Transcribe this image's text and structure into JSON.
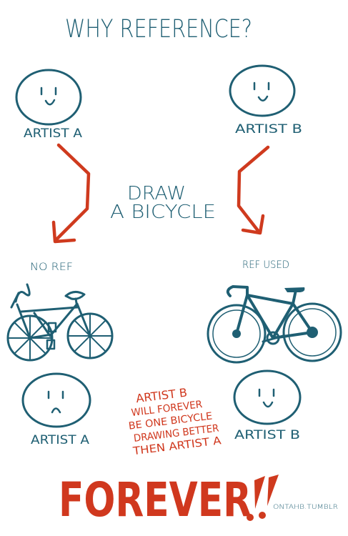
{
  "title": "WHY REFERENCE?",
  "artist_a_top": "ARTIST A",
  "artist_b_top": "ARTIST B",
  "task_line1": "DRAW",
  "task_line2": "A BICYCLE",
  "no_ref_label": "NO REF",
  "ref_used_label": "REF USED",
  "artist_a_bottom": "ARTIST A",
  "artist_b_bottom": "ARTIST B",
  "conclusion_lines": [
    "ARTIST B",
    "WILL FOREVER",
    "BE ONE BICYCLE",
    "DRAWING BETTER",
    "THEN ARTIST A"
  ],
  "forever": "FOREVER",
  "credit": "ONTAHB.TUMBLR",
  "colors": {
    "ink": "#1f5f73",
    "red": "#cf3a1e",
    "background": "#ffffff"
  }
}
